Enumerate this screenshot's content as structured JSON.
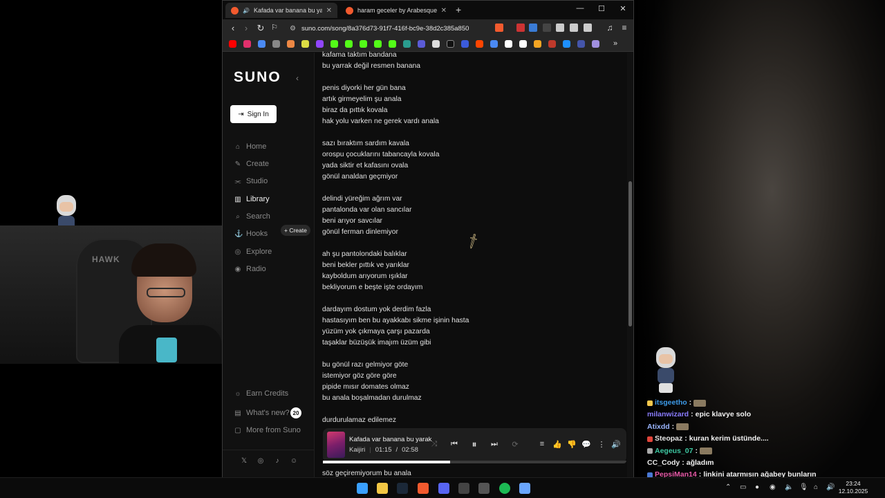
{
  "browser": {
    "tabs": [
      {
        "label": "Kafada var banana bu yarak d",
        "active": true,
        "audio": true
      },
      {
        "label": "haram geceler by ArabesqueClassica",
        "active": false,
        "audio": false
      }
    ],
    "url": "suno.com/song/8a376d73-91f7-416f-bc9e-38d2c385a850",
    "controls": {
      "new_tab": "+",
      "minimize": "—",
      "maximize": "☐",
      "close": "✕"
    }
  },
  "sidebar": {
    "logo": "SUNO",
    "sign_in": "Sign In",
    "nav": [
      {
        "label": "Home",
        "icon": "home-icon",
        "active": false
      },
      {
        "label": "Create",
        "icon": "create-icon",
        "active": false
      },
      {
        "label": "Studio",
        "icon": "studio-icon",
        "active": false
      },
      {
        "label": "Library",
        "icon": "library-icon",
        "active": true
      },
      {
        "label": "Search",
        "icon": "search-icon",
        "active": false
      },
      {
        "label": "Hooks",
        "icon": "hooks-icon",
        "active": false
      },
      {
        "label": "Explore",
        "icon": "explore-icon",
        "active": false
      },
      {
        "label": "Radio",
        "icon": "radio-icon",
        "active": false
      }
    ],
    "hooks_create": "+ Create",
    "footer": [
      {
        "label": "Earn Credits",
        "icon": "credits-icon"
      },
      {
        "label": "What's new?",
        "icon": "news-icon",
        "badge": "20"
      },
      {
        "label": "More from Suno",
        "icon": "more-icon"
      }
    ]
  },
  "lyrics": [
    "kafama taktım bandana",
    "bu yarrak değil resmen banana",
    "",
    "penis diyorki her gün bana",
    "artık girmeyelim şu anala",
    "biraz da pıttık kovala",
    "hak yolu varken ne gerek vardı anala",
    "",
    "sazı bıraktım sardım kavala",
    "orospu çocuklarını tabancayla kovala",
    "yada siktir et kafasını ovala",
    "gönül analdan geçmiyor",
    "",
    "delindi yüreğim ağrım var",
    "pantalonda var olan sancılar",
    "beni arıyor savcılar",
    "gönül ferman dinlemiyor",
    "",
    "ah şu pantolondaki balıklar",
    "beni bekler pıttık ve yarıklar",
    "kayboldum arıyorum ışıklar",
    "bekliyorum e beşte işte ordayım",
    "",
    "dardayım dostum yok derdim fazla",
    "hastasıyım ben bu ayakkabı sikme işinin hasta",
    "yüzüm yok çıkmaya çarşı pazarda",
    "taşaklar büzüşük imajım üzüm gibi",
    "",
    "bu gönül razı gelmiyor göte",
    "istemiyor göz göre göre",
    "pipide mısır domates olmaz",
    "bu anala boşalmadan durulmaz",
    "",
    "durdurulamaz edilemez"
  ],
  "lyrics_below_player": "söz geçiremiyorum bu anala",
  "player": {
    "title": "Kafada var banana bu yarak",
    "artist": "Kaijiri",
    "current_time": "01:15",
    "separator": "/",
    "duration": "02:58",
    "progress": 0.42
  },
  "chat": [
    {
      "user": "itsgeetho",
      "msg": "",
      "color": "#3d9be9",
      "badge": "#f5c84c"
    },
    {
      "user": "milanwizard",
      "msg": "epic klavye solo",
      "color": "#8a7cff",
      "badge": ""
    },
    {
      "user": "Atixdd",
      "msg": "",
      "color": "#9bb6ff",
      "badge": ""
    },
    {
      "user": "Steopaz",
      "msg": "kuran kerim üstünde....",
      "color": "#e7e7e7",
      "badge": "#e0443a"
    },
    {
      "user": "Aegeus_07",
      "msg": "",
      "color": "#3ec7a2",
      "badge": "#aaaaaa"
    },
    {
      "user": "CC_Cody",
      "msg": "ağladım",
      "color": "#e7e7e7",
      "badge": ""
    },
    {
      "user": "PepsiMan14",
      "msg": "linkini atarmısın ağabey bunların",
      "color": "#e85aa8",
      "badge": "#4a78d4"
    }
  ],
  "taskbar": {
    "time": "23:24",
    "date": "12.10.2025"
  },
  "webcam": {
    "chair_logo": "HAWK"
  }
}
